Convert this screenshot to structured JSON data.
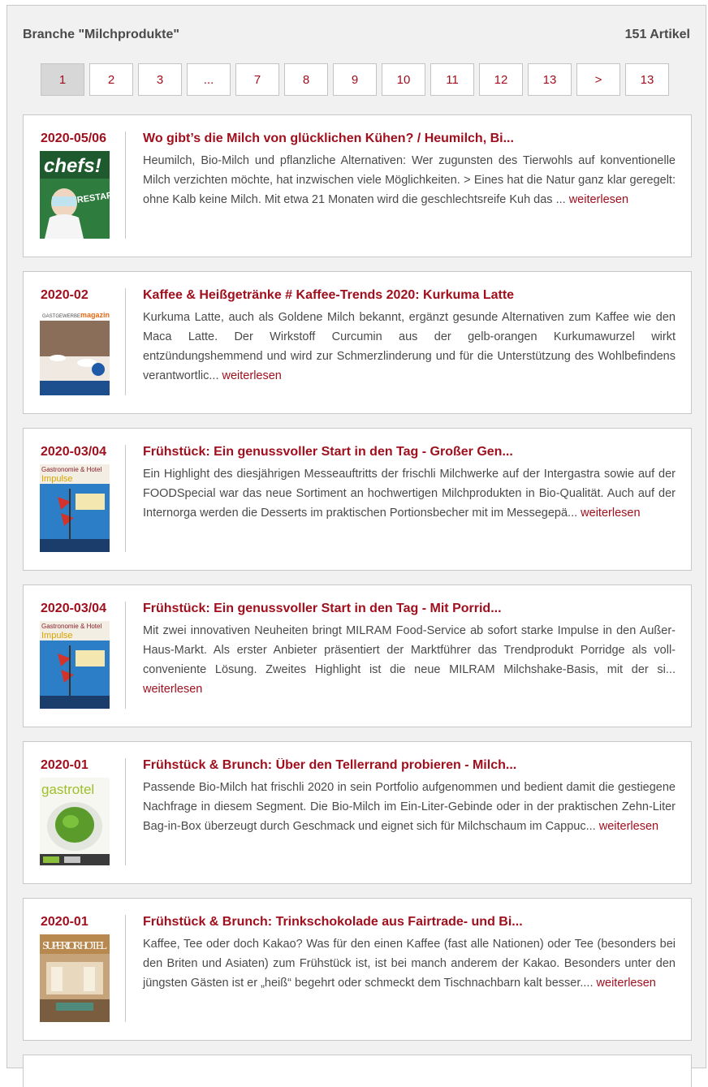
{
  "header": {
    "title": "Branche \"Milchprodukte\"",
    "count": "151 Artikel"
  },
  "pager": [
    "1",
    "2",
    "3",
    "...",
    "7",
    "8",
    "9",
    "10",
    "11",
    "12",
    "13",
    ">",
    "13"
  ],
  "articles": [
    {
      "date": "2020-05/06",
      "title": "Wo gibt’s die Milch von glücklichen Kühen? / Heumilch, Bi...",
      "text": "Heumilch, Bio-Milch und pflanzliche Alternativen: Wer zugunsten des Tierwohls auf konventionelle Milch verzichten möchte, hat inzwischen viele Möglichkeiten. > Eines hat die Natur ganz klar geregelt: ohne Kalb keine Milch. Mit etwa 21 Monaten wird die geschlechtsreife Kuh das ...",
      "more": "weiterlesen",
      "cover": {
        "logo": "chefs!",
        "headline": "RESTART"
      }
    },
    {
      "date": "2020-02",
      "title": "Kaffee & Heißgetränke # Kaffee-Trends 2020: Kurkuma Latte",
      "text": "Kurkuma Latte, auch als Goldene Milch bekannt, ergänzt gesunde Alternativen zum Kaffee wie den Maca Latte. Der Wirkstoff Curcumin aus der gelb-orangen Kurkumawurzel wirkt entzündungshemmend und wird zur Schmerzlinderung und für die Unterstützung des Wohlbefindens verantwortlic...",
      "more": "weiterlesen",
      "cover": {
        "logo": "GASTGEWERBE",
        "logo2": "magazin"
      }
    },
    {
      "date": "2020-03/04",
      "title": "Frühstück: Ein genussvoller Start in den Tag - Großer Gen...",
      "text": "Ein Highlight des diesjährigen Messeauftritts der frischli Milchwerke auf der Intergastra sowie auf der FOODSpecial war das neue Sortiment an hochwertigen Milchprodukten in Bio-Qualität. Auch auf der Internorga werden die Desserts im praktischen Portionsbecher mit im Messegepä...",
      "more": "weiterlesen",
      "cover": {
        "logo": "Gastronomie & Hotel",
        "logo2": "Impulse"
      }
    },
    {
      "date": "2020-03/04",
      "title": "Frühstück: Ein genussvoller Start in den Tag - Mit Porrid...",
      "text": "Mit zwei innovativen Neuheiten bringt MILRAM Food-Service ab sofort starke Impulse in den Außer-Haus-Markt. Als erster Anbieter präsentiert der Marktführer das Trendprodukt Porridge als voll-conveniente Lösung. Zweites Highlight ist die neue MILRAM Milchshake-Basis, mit der si...",
      "more": "weiterlesen",
      "cover": {
        "logo": "Gastronomie & Hotel",
        "logo2": "Impulse"
      }
    },
    {
      "date": "2020-01",
      "title": "Frühstück & Brunch: Über den Tellerrand probieren - Milch...",
      "text": "Passende Bio-Milch hat frischli 2020 in sein Portfolio aufgenommen und bedient damit die gestiegene Nachfrage in diesem Segment. Die Bio-Milch im Ein-Liter-Gebinde oder in der praktischen Zehn-Liter Bag-in-Box überzeugt durch Geschmack und eignet sich für Milchschaum im Cappuc...",
      "more": "weiterlesen",
      "cover": {
        "logo": "gastrotel"
      }
    },
    {
      "date": "2020-01",
      "title": "Frühstück & Brunch: Trinkschokolade aus Fairtrade- und Bi...",
      "text": "Kaffee, Tee oder doch Kakao? Was für den einen Kaffee (fast alle Nationen) oder Tee (besonders bei den Briten und Asiaten) zum Frühstück ist, ist bei manch anderem der Kakao. Besonders unter den jüngsten Gästen ist er „heiß“ begehrt oder schmeckt dem Tischnachbarn kalt besser....",
      "more": "weiterlesen",
      "cover": {
        "logo": "SUPERIOR HOTEL"
      }
    }
  ]
}
